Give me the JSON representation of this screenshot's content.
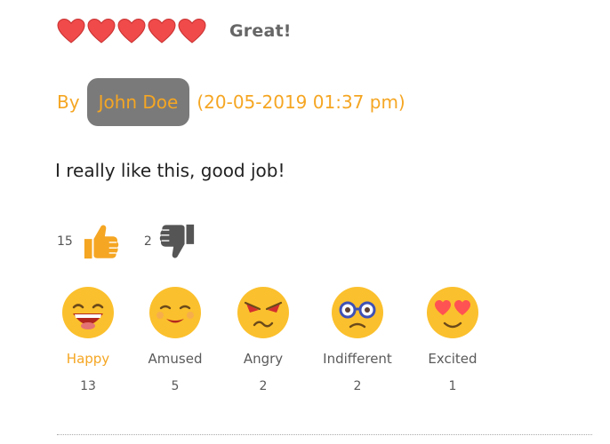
{
  "review": {
    "rating": 5,
    "rating_max": 5,
    "title": "Great!",
    "by_label": "By",
    "author": "John Doe",
    "date": "(20-05-2019 01:37 pm)",
    "comment": "I really like this, good job!"
  },
  "votes": {
    "up_count": "15",
    "down_count": "2"
  },
  "reactions": [
    {
      "label": "Happy",
      "count": "13",
      "icon": "happy-face-icon",
      "active": true
    },
    {
      "label": "Amused",
      "count": "5",
      "icon": "amused-face-icon",
      "active": false
    },
    {
      "label": "Angry",
      "count": "2",
      "icon": "angry-face-icon",
      "active": false
    },
    {
      "label": "Indifferent",
      "count": "2",
      "icon": "indifferent-face-icon",
      "active": false
    },
    {
      "label": "Excited",
      "count": "1",
      "icon": "excited-face-icon",
      "active": false
    }
  ],
  "colors": {
    "accent": "#f5a623",
    "heart": "#f04a4a",
    "author_chip_bg": "#7a7a7a",
    "emoji_face": "#fbc02d"
  }
}
